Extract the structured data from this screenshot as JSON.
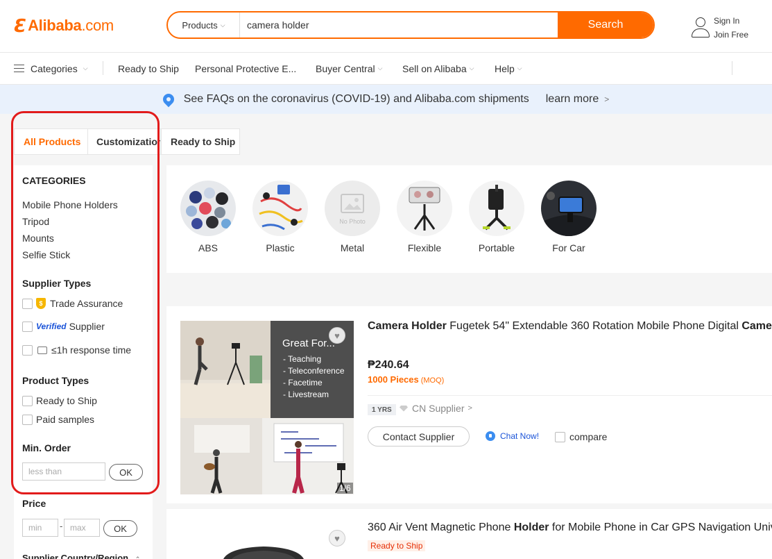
{
  "header": {
    "logo_text": "Alibaba",
    "logo_suffix": ".com",
    "search_category": "Products",
    "search_value": "camera holder",
    "search_button": "Search",
    "sign_in": "Sign In",
    "join_free": "Join Free"
  },
  "nav": {
    "categories": "Categories",
    "items": [
      "Ready to Ship",
      "Personal Protective E...",
      "Buyer Central",
      "Sell on Alibaba",
      "Help"
    ]
  },
  "banner": {
    "text": "See FAQs on the coronavirus (COVID-19) and Alibaba.com shipments",
    "link": "learn more"
  },
  "tabs": [
    "All Products",
    "Customization",
    "Ready to Ship"
  ],
  "sidebar": {
    "categories_heading": "CATEGORIES",
    "categories": [
      "Mobile Phone Holders",
      "Tripod",
      "Mounts",
      "Selfie Stick"
    ],
    "supplier_types_heading": "Supplier Types",
    "trade_assurance": "Trade Assurance",
    "verified_badge": "Verified",
    "supplier": "Supplier",
    "response_time": "≤1h response time",
    "product_types_heading": "Product Types",
    "ready_to_ship": "Ready to Ship",
    "paid_samples": "Paid samples",
    "min_order_heading": "Min. Order",
    "min_order_placeholder": "less than",
    "ok": "OK",
    "price_heading": "Price",
    "price_min": "min",
    "price_dash": "-",
    "price_max": "max",
    "supplier_country": "Supplier Country/Region"
  },
  "attributes": [
    {
      "label": "ABS",
      "icon": "abs-popsockets-thumbnail"
    },
    {
      "label": "Plastic",
      "icon": "plastic-clips-thumbnail"
    },
    {
      "label": "Metal",
      "icon": "no-photo-thumbnail",
      "placeholder": "No Photo"
    },
    {
      "label": "Flexible",
      "icon": "flexible-tripod-thumbnail"
    },
    {
      "label": "Portable",
      "icon": "portable-tripod-thumbnail"
    },
    {
      "label": "For Car",
      "icon": "car-mount-thumbnail"
    }
  ],
  "product1": {
    "title_bold": "Camera Holder",
    "title_rest": " Fugetek 54\" Extendable 360 Rotation Mobile Phone Digital ",
    "title_bold2": "Camera",
    "image_heading": "Great For...",
    "image_list": [
      "- Teaching",
      "- Teleconference",
      "- Facetime",
      "- Livestream"
    ],
    "image_counter": "1/6",
    "price": "₱240.64",
    "moq": "1000 Pieces",
    "moq_tag": "(MOQ)",
    "years": "1 YRS",
    "supplier": "CN Supplier",
    "contact": "Contact Supplier",
    "chat": "Chat Now!",
    "compare": "compare"
  },
  "product2": {
    "title_pre": "360 Air Vent Magnetic Phone ",
    "title_bold": "Holder",
    "title_rest": " for Mobile Phone in Car GPS Navigation Univ",
    "tag": "Ready to Ship"
  },
  "colors": {
    "accent": "#ff6a00",
    "highlight_outline": "#e21b1b",
    "link_blue": "#1a53d8"
  }
}
